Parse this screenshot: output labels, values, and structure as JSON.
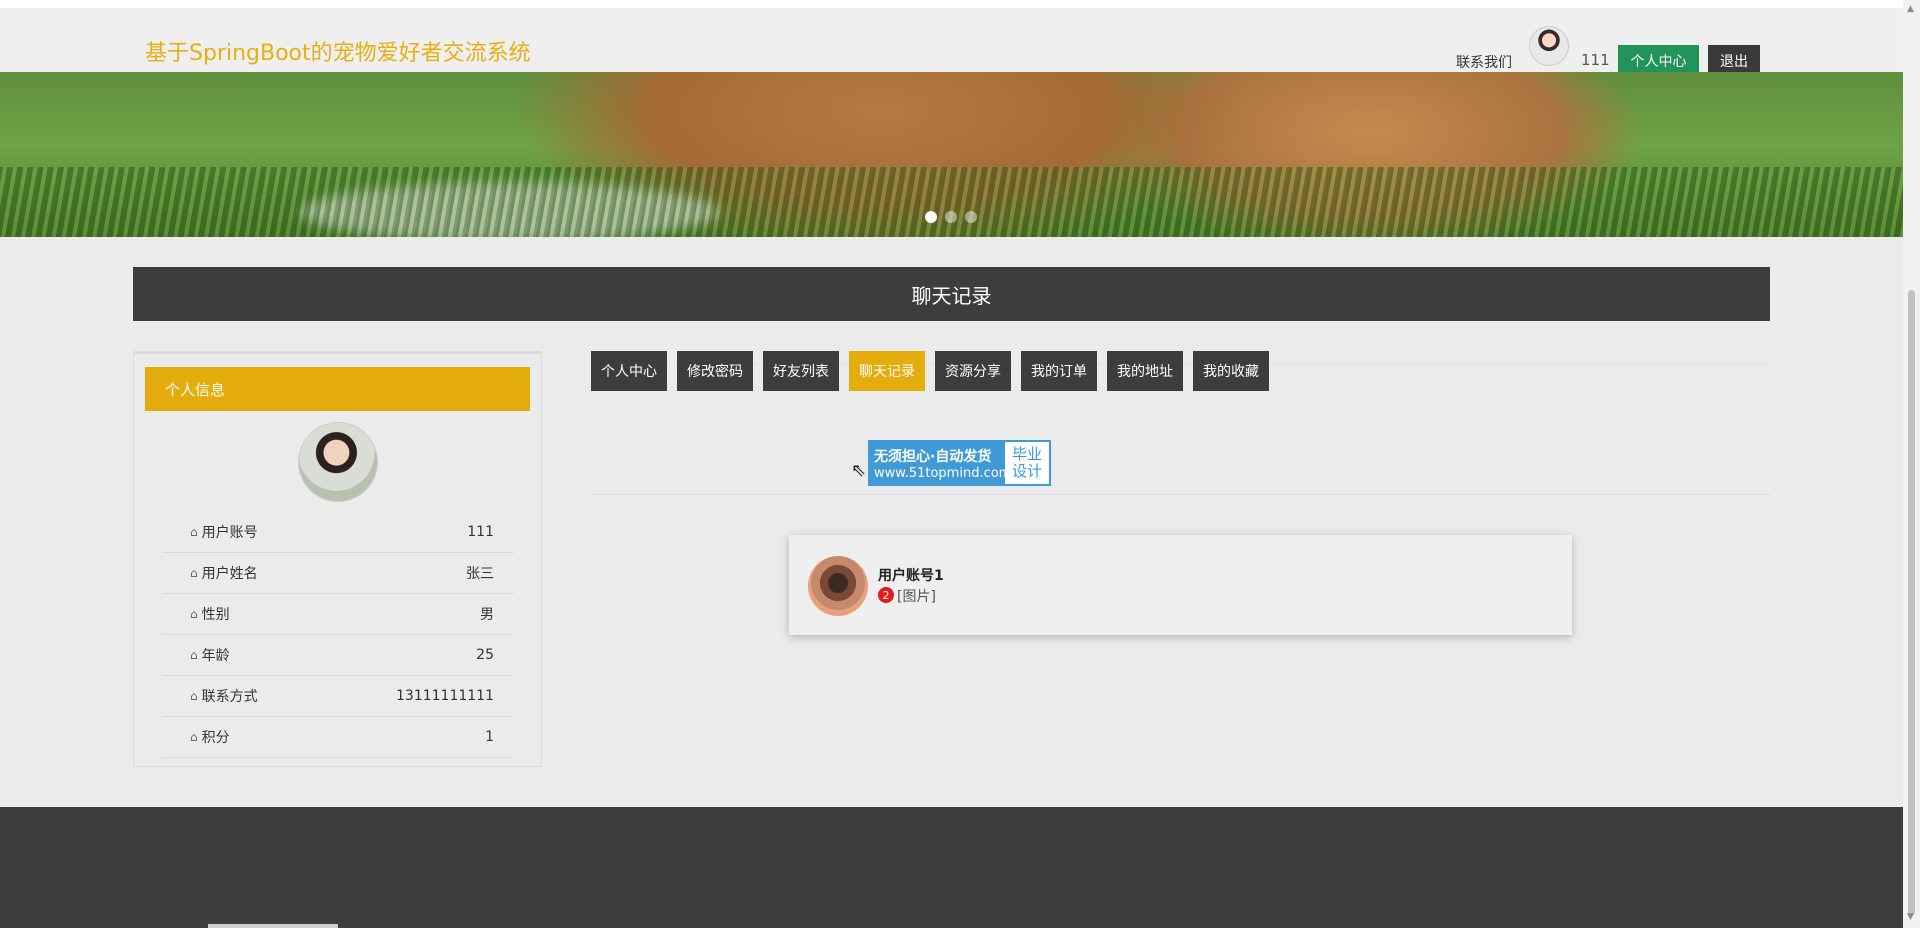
{
  "header": {
    "site_title": "基于SpringBoot的宠物爱好者交流系统",
    "contact_label": "联系我们",
    "username": "111",
    "center_button": "个人中心",
    "logout_button": "退出"
  },
  "banner": {
    "slide_count": 3,
    "active_slide": 1
  },
  "page_title": "聊天记录",
  "profile": {
    "heading": "个人信息",
    "rows": [
      {
        "label": "用户账号",
        "value": "111"
      },
      {
        "label": "用户姓名",
        "value": "张三"
      },
      {
        "label": "性别",
        "value": "男"
      },
      {
        "label": "年龄",
        "value": "25"
      },
      {
        "label": "联系方式",
        "value": "13111111111"
      },
      {
        "label": "积分",
        "value": "1"
      }
    ]
  },
  "tabs": [
    {
      "label": "个人中心",
      "active": false
    },
    {
      "label": "修改密码",
      "active": false
    },
    {
      "label": "好友列表",
      "active": false
    },
    {
      "label": "聊天记录",
      "active": true
    },
    {
      "label": "资源分享",
      "active": false
    },
    {
      "label": "我的订单",
      "active": false
    },
    {
      "label": "我的地址",
      "active": false
    },
    {
      "label": "我的收藏",
      "active": false
    }
  ],
  "watermark": {
    "line1": "无须担心·自动发货",
    "line2": "www.51topmind.com",
    "right1": "毕业",
    "right2": "设计"
  },
  "chat": {
    "name": "用户账号1",
    "unread": "2",
    "message": "[图片]"
  },
  "colors": {
    "accent": "#e5ac0e",
    "dark": "#3d3d3d",
    "green": "#22935a",
    "badge": "#e01b1b"
  }
}
